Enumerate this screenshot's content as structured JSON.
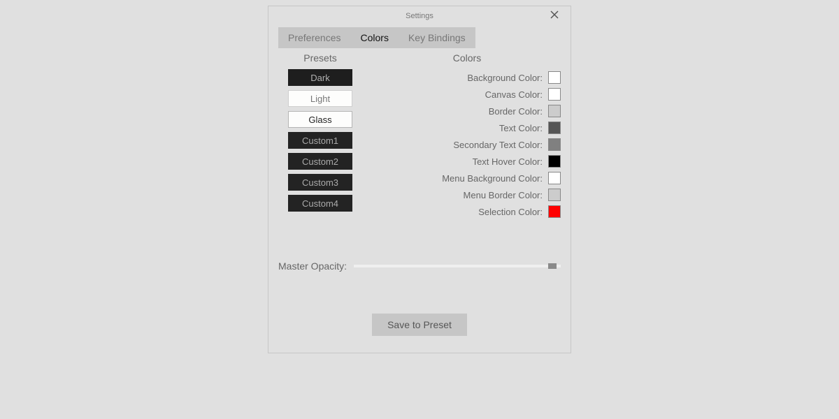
{
  "window": {
    "title": "Settings"
  },
  "tabs": [
    {
      "label": "Preferences",
      "active": false
    },
    {
      "label": "Colors",
      "active": true
    },
    {
      "label": "Key Bindings",
      "active": false
    }
  ],
  "presets": {
    "title": "Presets",
    "items": [
      {
        "label": "Dark",
        "style": "dark"
      },
      {
        "label": "Light",
        "style": "light"
      },
      {
        "label": "Glass",
        "style": "glass",
        "selected": true
      },
      {
        "label": "Custom1",
        "style": "custom"
      },
      {
        "label": "Custom2",
        "style": "custom"
      },
      {
        "label": "Custom3",
        "style": "custom"
      },
      {
        "label": "Custom4",
        "style": "custom"
      }
    ]
  },
  "colors": {
    "title": "Colors",
    "rows": [
      {
        "label": "Background Color:",
        "value": "#ffffff"
      },
      {
        "label": "Canvas Color:",
        "value": "#ffffff"
      },
      {
        "label": "Border Color:",
        "value": "#cccccc"
      },
      {
        "label": "Text Color:",
        "value": "#555555"
      },
      {
        "label": "Secondary Text Color:",
        "value": "#808080"
      },
      {
        "label": "Text Hover Color:",
        "value": "#000000"
      },
      {
        "label": "Menu Background Color:",
        "value": "#ffffff"
      },
      {
        "label": "Menu Border Color:",
        "value": "#cccccc"
      },
      {
        "label": "Selection Color:",
        "value": "#ff0000"
      }
    ]
  },
  "opacity": {
    "label": "Master Opacity:",
    "value": 0.98
  },
  "save": {
    "label": "Save to Preset"
  }
}
